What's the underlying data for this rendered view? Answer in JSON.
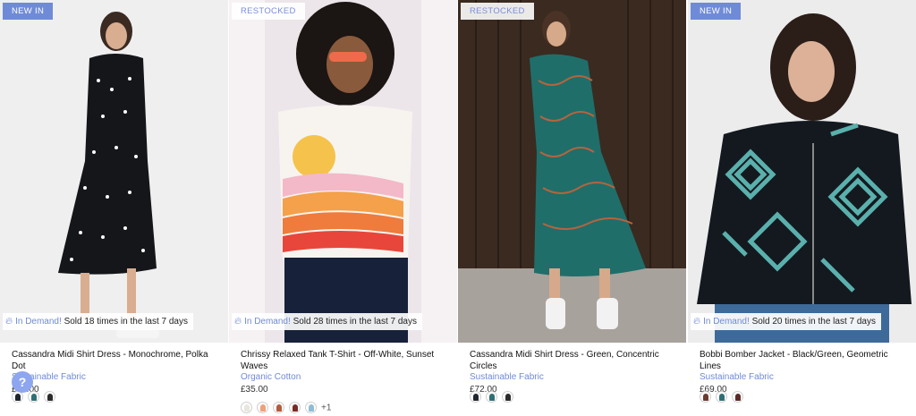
{
  "products": [
    {
      "badge": "NEW IN",
      "demand_label": "In Demand!",
      "demand_text": "Sold 18 times in the last 7 days",
      "name": "Cassandra Midi Shirt Dress - Monochrome, Polka Dot",
      "fabric": "Sustainable Fabric",
      "price": "£72.00",
      "swatch_colors": [
        "#1f2530",
        "#2f6f76",
        "#2b2b2b"
      ]
    },
    {
      "badge": "RESTOCKED",
      "demand_label": "In Demand!",
      "demand_text": "Sold 28 times in the last 7 days",
      "name": "Chrissy Relaxed Tank T-Shirt - Off-White, Sunset Waves",
      "fabric": "Organic Cotton",
      "price": "£35.00",
      "swatch_colors": [
        "#e9e6df",
        "#f0a07a",
        "#b65a3c",
        "#7a2a24",
        "#8fbcd6"
      ],
      "more_swatches": "+1"
    },
    {
      "badge": "RESTOCKED",
      "name": "Cassandra Midi Shirt Dress - Green, Concentric Circles",
      "fabric": "Sustainable Fabric",
      "price": "£72.00",
      "swatch_colors": [
        "#1f2530",
        "#2f6f76",
        "#2b2b2b"
      ]
    },
    {
      "badge": "NEW IN",
      "demand_label": "In Demand!",
      "demand_text": "Sold 20 times in the last 7 days",
      "name": "Bobbi Bomber Jacket - Black/Green, Geometric Lines",
      "fabric": "Sustainable Fabric",
      "price": "£69.00",
      "swatch_colors": [
        "#6b3a2e",
        "#2f6f76",
        "#5a2a2a"
      ]
    }
  ],
  "help_button": "?",
  "colors": {
    "accent": "#6f8bd8",
    "help": "#8ea6ef"
  }
}
